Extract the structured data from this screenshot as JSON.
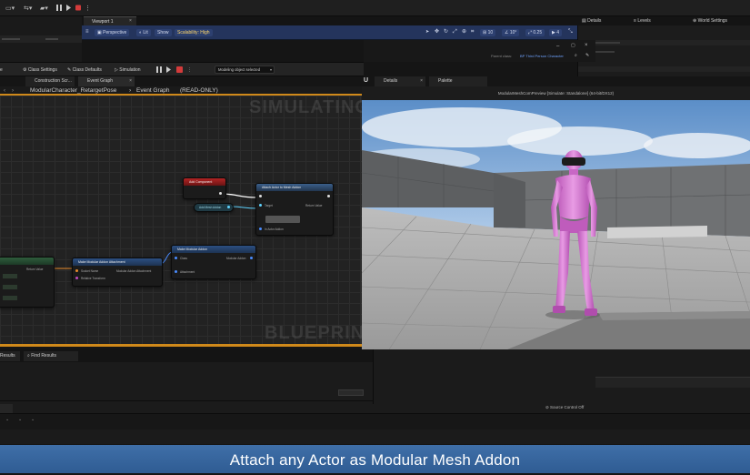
{
  "toolbar": {
    "viewport_tab": "Viewport 1",
    "perspective_label": "Perspective",
    "lit_label": "Lit",
    "show_label": "Show",
    "scalability_label": "Scalability: High",
    "grid_snap_value": "10",
    "rot_snap_value": "10°",
    "scale_snap_value": "0.25",
    "camera_speed_value": "4"
  },
  "details": {
    "tabs": [
      "Details",
      "Levels",
      "World Settings"
    ],
    "parent_class_label": "Parent class:",
    "parent_class_value": "BP Third Person Character",
    "dropdown_value": "None"
  },
  "class_toolbar": {
    "class_settings": "Class Settings",
    "class_defaults": "Class Defaults",
    "simulation": "Simulation",
    "debug_object": "Modeling object selected"
  },
  "graph_tabs": {
    "construction": "Construction Scr...",
    "event_graph": "Event Graph"
  },
  "breadcrumb": {
    "path": "ModularCharacter_RetargetPose",
    "current": "Event Graph",
    "mode": "(READ-ONLY)"
  },
  "graph": {
    "watermark_top": "SIMULATING",
    "watermark_bottom": "BLUEPRINT",
    "nodes": {
      "event": "Add Component",
      "attach": "Attach Actor to Mesh Addon",
      "var": "Add Mesh Addon",
      "modular": "Make Modular Addon Attachment",
      "struct": "Make Modular Addon"
    }
  },
  "preview": {
    "tabs": [
      "Details",
      "Palette"
    ],
    "title": "ModularMeshComPreview [Simulate: Standalone] (64-bit/DX12)"
  },
  "bottom": {
    "tab_compiler": "Results",
    "tab_find": "Find Results",
    "source_control": "Source Control Off"
  },
  "banner": {
    "text": "Attach any Actor as Modular Mesh Addon"
  },
  "colors": {
    "accent_orange": "#d0891a",
    "viewport_toolbar_blue": "#24345c",
    "banner_blue": "#3f6fa8",
    "mesh_pink": "#d97ad6"
  }
}
